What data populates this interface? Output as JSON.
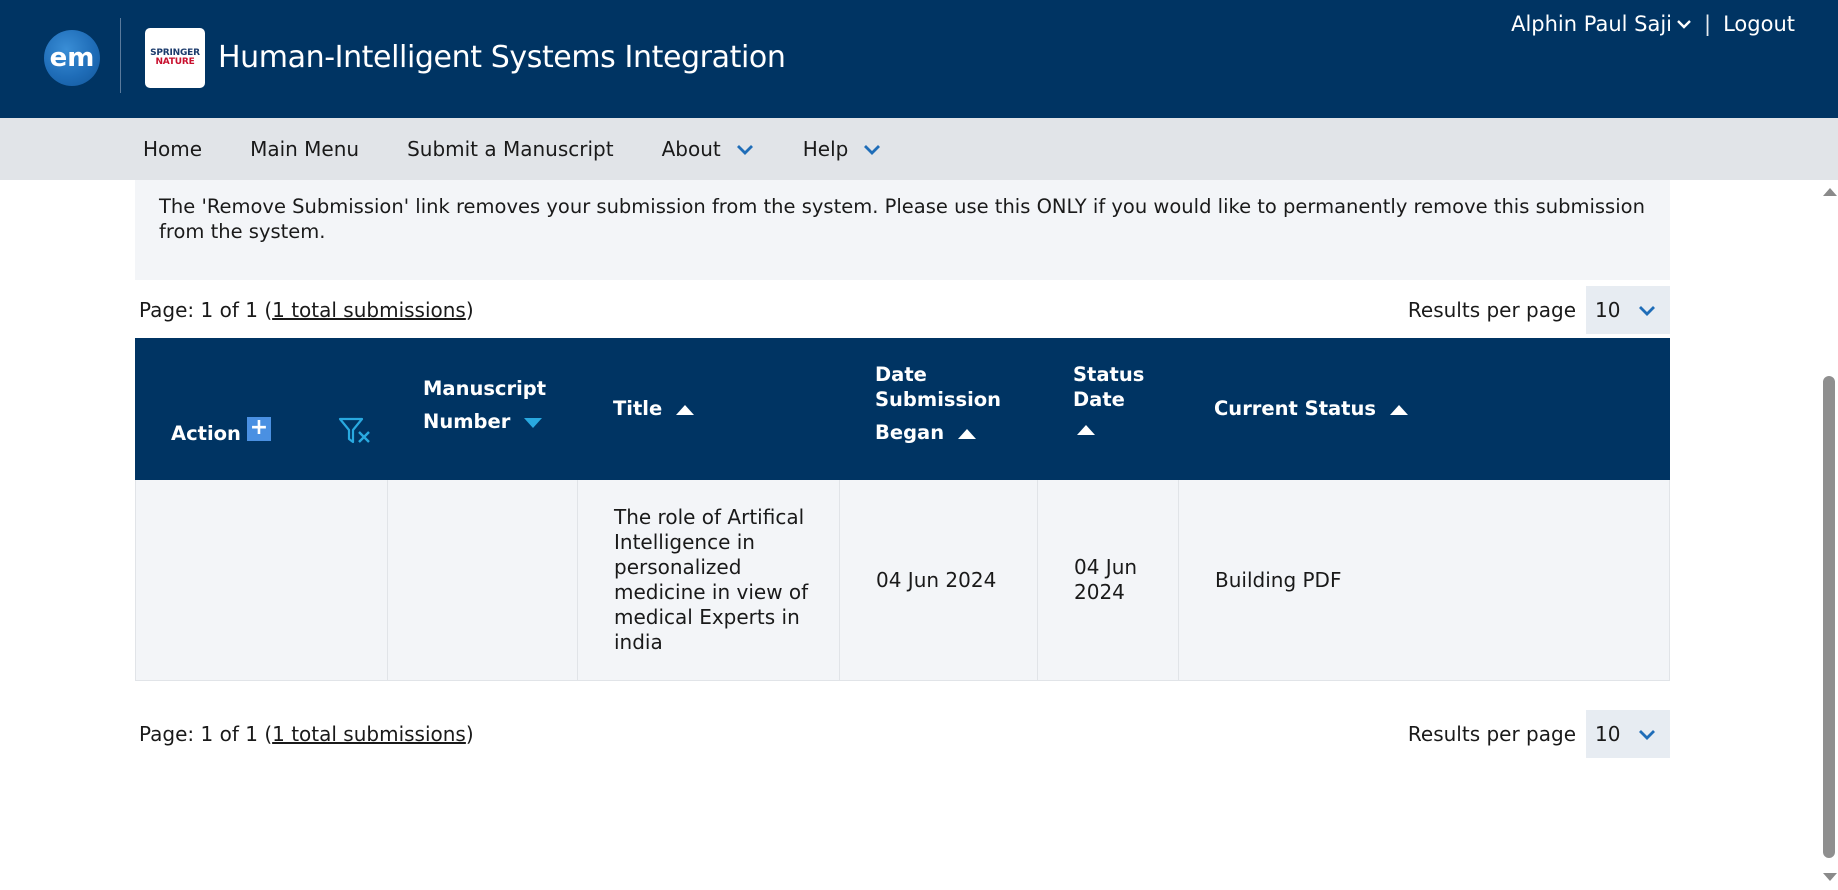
{
  "header": {
    "logo_em": "em",
    "publisher_line1": "SPRINGER",
    "publisher_line2": "NATURE",
    "journal_title": "Human-Intelligent Systems Integration",
    "user_name": "Alphin Paul Saji",
    "separator": "|",
    "logout_label": "Logout"
  },
  "nav": {
    "home": "Home",
    "main_menu": "Main Menu",
    "submit": "Submit a Manuscript",
    "about": "About",
    "help": "Help"
  },
  "info_text": "The 'Remove Submission' link removes your submission from the system. Please use this ONLY if you would like to permanently remove this submission from the system.",
  "pager": {
    "page_prefix": "Page: 1 of 1 (",
    "total_link": "1 total submissions",
    "page_suffix": ")",
    "results_label": "Results per page",
    "per_page_value": "10"
  },
  "table": {
    "headers": {
      "action": "Action",
      "manuscript_line1": "Manuscript",
      "manuscript_line2": "Number",
      "title": "Title",
      "date_line1": "Date",
      "date_line2": "Submission",
      "date_line3": "Began",
      "status_line1": "Status",
      "status_line2": "Date",
      "current_status": "Current Status"
    },
    "rows": [
      {
        "action": "",
        "manuscript_number": "",
        "title": "The role of Artifical Intelligence in personalized medicine in view of medical Experts in india",
        "date_submission_began": "04 Jun 2024",
        "status_date": "04 Jun 2024",
        "current_status": "Building PDF"
      }
    ]
  },
  "colors": {
    "header_bg": "#003463",
    "nav_bg": "#e1e4e8",
    "panel_bg": "#f3f5f8",
    "accent": "#1f6db8",
    "sort_active": "#29a9e0"
  }
}
